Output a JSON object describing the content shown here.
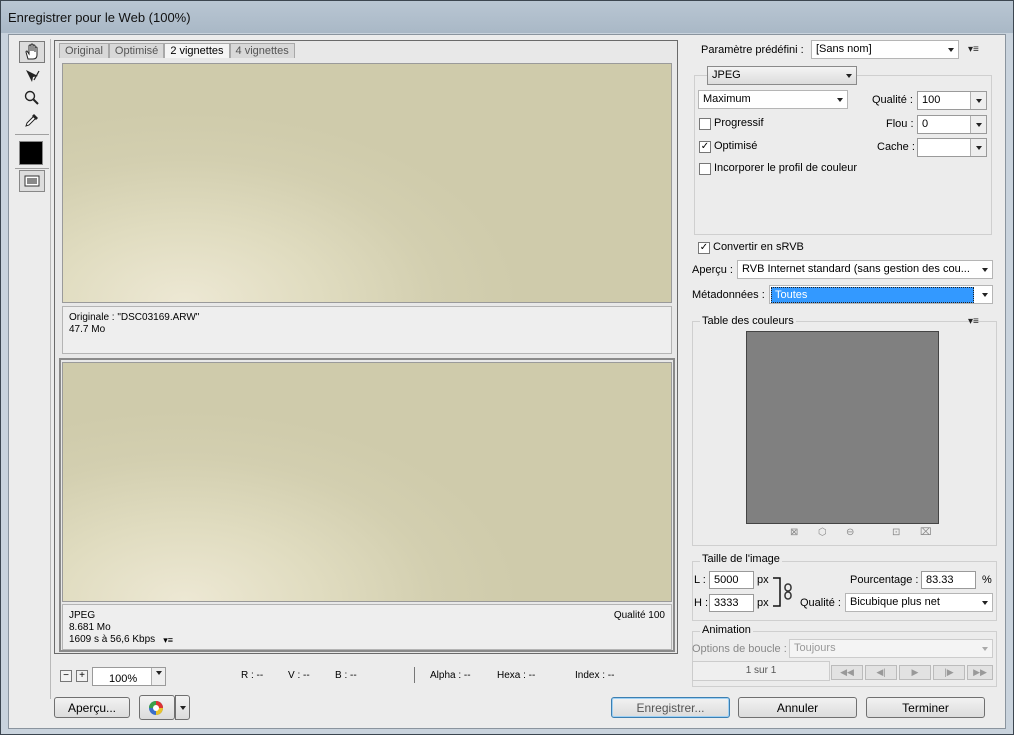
{
  "window": {
    "title": "Enregistrer pour le Web (100%)"
  },
  "preview": {
    "tabs": [
      "Original",
      "Optimisé",
      "2 vignettes",
      "4 vignettes"
    ],
    "active_tab": "2 vignettes",
    "top_pane": {
      "line1": "Originale : \"DSC03169.ARW\"",
      "line2": "47.7 Mo"
    },
    "bottom_pane": {
      "format": "JPEG",
      "size": "8.681 Mo",
      "time": "1609 s à 56,6 Kbps",
      "quality": "Qualité 100"
    }
  },
  "status": {
    "minus": "−",
    "plus": "+",
    "zoom": "100%",
    "r": "R : --",
    "v": "V : --",
    "b": "B : --",
    "alpha": "Alpha : --",
    "hexa": "Hexa : --",
    "index": "Index : --"
  },
  "settings": {
    "preset_label": "Paramètre prédéfini :",
    "preset_value": "[Sans nom]",
    "format": "JPEG",
    "quality_mode": "Maximum",
    "quality_label": "Qualité :",
    "quality_value": "100",
    "progressive_label": "Progressif",
    "progressive_checked": false,
    "blur_label": "Flou :",
    "blur_value": "0",
    "optimized_label": "Optimisé",
    "optimized_checked": true,
    "matte_label": "Cache :",
    "matte_value": "",
    "embed_profile_label": "Incorporer le profil de couleur",
    "embed_profile_checked": false,
    "convert_srgb_label": "Convertir en sRVB",
    "convert_srgb_checked": true,
    "preview_label": "Aperçu :",
    "preview_value": "RVB Internet standard (sans gestion des cou...",
    "metadata_label": "Métadonnées :",
    "metadata_value": "Toutes"
  },
  "color_table": {
    "title": "Table des couleurs",
    "swatch_color": "#808080"
  },
  "image_size": {
    "title": "Taille de l'image",
    "w_label": "L :",
    "w_value": "5000",
    "w_unit": "px",
    "h_label": "H :",
    "h_value": "3333",
    "h_unit": "px",
    "percent_label": "Pourcentage :",
    "percent_value": "83.33",
    "percent_unit": "%",
    "quality_label": "Qualité :",
    "quality_value": "Bicubique plus net"
  },
  "animation": {
    "title": "Animation",
    "loop_label": "Options de boucle :",
    "loop_value": "Toujours",
    "frame_counter": "1 sur 1"
  },
  "buttons": {
    "preview": "Aperçu...",
    "save": "Enregistrer...",
    "cancel": "Annuler",
    "done": "Terminer"
  },
  "icons": {
    "hand": "hand-tool-icon",
    "slice": "slice-select-icon",
    "zoom": "zoom-icon",
    "eyedropper": "eyedropper-icon",
    "color": "eyedropper-color-swatch",
    "toggle": "toggle-slices-icon",
    "browser": "browser-preview-icon",
    "menu": "panel-menu-icon",
    "link": "constrain-proportions-icon"
  }
}
